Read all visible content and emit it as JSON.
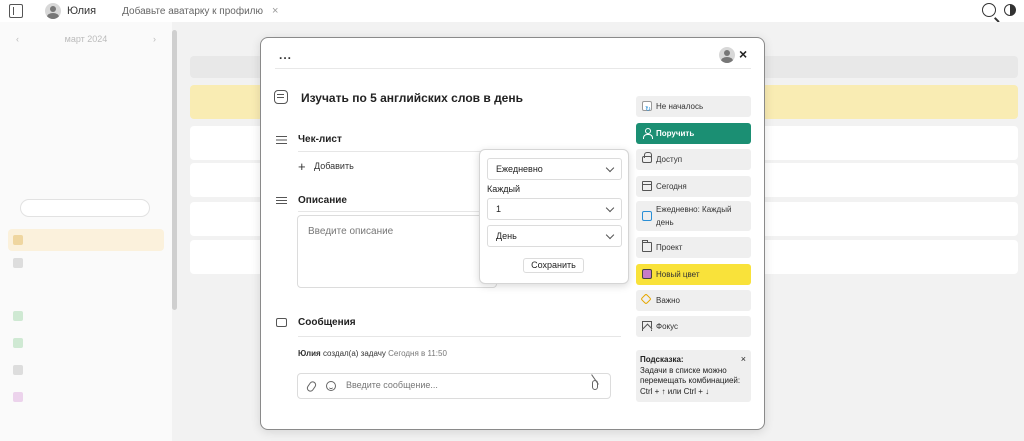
{
  "topbar": {
    "user_name": "Юлия",
    "avatar_hint": "Добавьте аватарку к профилю",
    "hint_close": "×"
  },
  "background": {
    "calendar_month": "март 2024",
    "calendar_prev": "‹",
    "calendar_next": "›"
  },
  "modal": {
    "menu_label": "...",
    "close_label": "×",
    "task_title": "Изучать по 5 английских слов в день",
    "checklist": {
      "heading": "Чек-лист",
      "add_icon": "+",
      "add_label": "Добавить"
    },
    "description": {
      "heading": "Описание",
      "placeholder": "Введите описание"
    },
    "messages": {
      "heading": "Сообщения",
      "log_user": "Юлия",
      "log_action": "создал(а) задачу",
      "log_time": "Сегодня в 11:50",
      "input_placeholder": "Введите сообщение..."
    },
    "sidebar": {
      "status": "Не началось",
      "assign": "Поручить",
      "access": "Доступ",
      "date": "Сегодня",
      "repeat": "Ежедневно: Каждый день",
      "project": "Проект",
      "color": "Новый цвет",
      "important": "Важно",
      "focus": "Фокус"
    },
    "tip": {
      "title": "Подсказка:",
      "text": "Задачи в списке можно перемещать комбинацией: Ctrl + ↑ или Ctrl + ↓",
      "close": "×"
    }
  },
  "repeat_popup": {
    "frequency": "Ежедневно",
    "each_label": "Каждый",
    "interval": "1",
    "unit": "День",
    "save_label": "Сохранить"
  },
  "colors": {
    "accent_green": "#1b8f73",
    "accent_yellow": "#f9e23a"
  }
}
